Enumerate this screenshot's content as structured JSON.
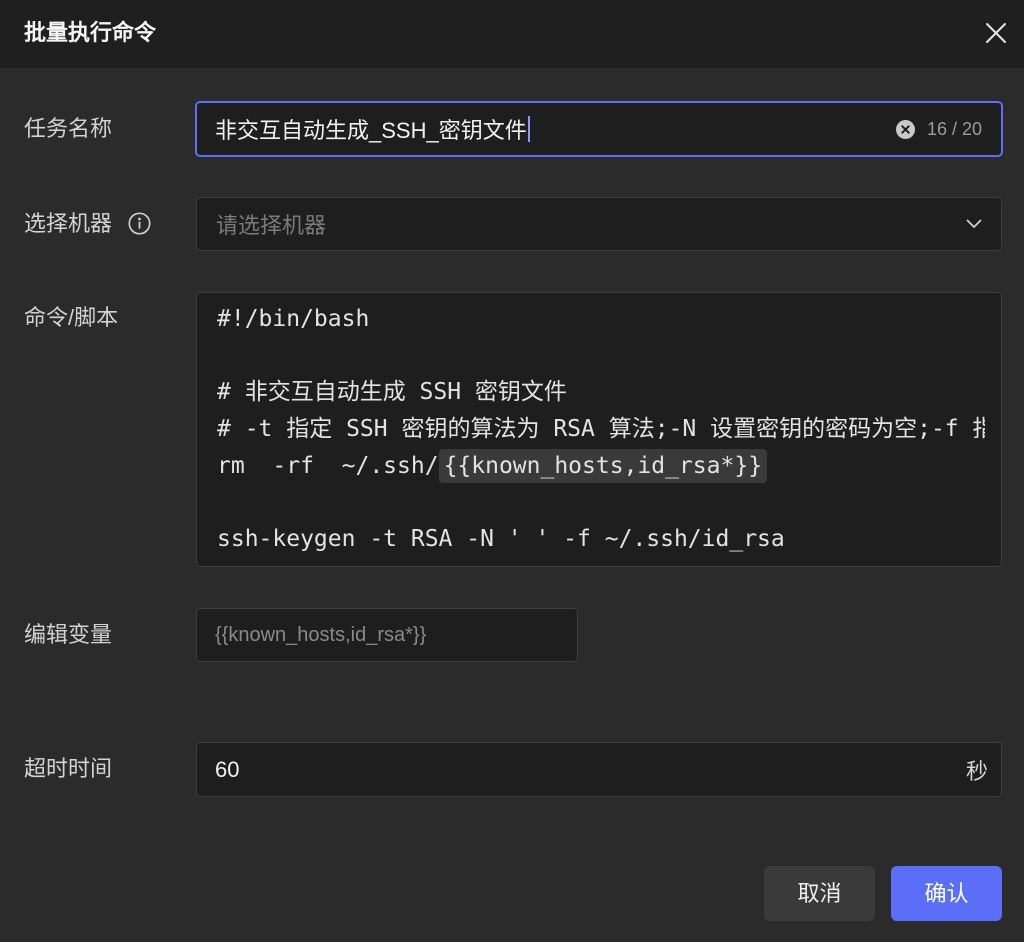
{
  "dialog": {
    "title": "批量执行命令",
    "close_icon": "close-icon"
  },
  "form": {
    "task_name": {
      "label": "任务名称",
      "value": "非交互自动生成_SSH_密钥文件",
      "counter": "16 / 20",
      "clear_icon": "clear-circle-icon"
    },
    "machine": {
      "label": "选择机器",
      "info_icon": "info-icon",
      "placeholder": "请选择机器",
      "dropdown_icon": "chevron-down-icon"
    },
    "script": {
      "label": "命令/脚本",
      "lines": [
        {
          "text": "#!/bin/bash"
        },
        {
          "text": ""
        },
        {
          "text": "# 非交互自动生成 SSH 密钥文件"
        },
        {
          "text": "# -t 指定 SSH 密钥的算法为 RSA 算法;-N 设置密钥的密码为空;-f 指"
        },
        {
          "text": "rm  -rf  ~/.ssh/",
          "variable": "{{known_hosts,id_rsa*}}"
        },
        {
          "text": ""
        },
        {
          "text": "ssh-keygen -t RSA -N ' ' -f ~/.ssh/id_rsa"
        }
      ]
    },
    "variables": {
      "label": "编辑变量",
      "placeholder": "{{known_hosts,id_rsa*}}"
    },
    "timeout": {
      "label": "超时时间",
      "value": "60",
      "unit": "秒"
    }
  },
  "footer": {
    "cancel_label": "取消",
    "confirm_label": "确认"
  },
  "colors": {
    "accent": "#5c6ef8"
  }
}
